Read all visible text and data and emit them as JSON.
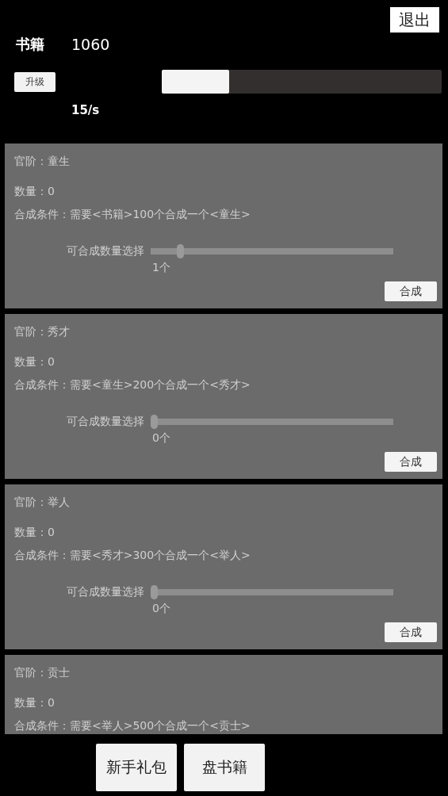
{
  "exit_button": "退出",
  "resource": {
    "label": "书籍",
    "value": "1060",
    "rate": "15/s"
  },
  "upgrade_button": "升级",
  "progress": {
    "level": 0.24
  },
  "ranks": [
    {
      "title": "官阶：童生",
      "count": "数量：0",
      "condition": "合成条件：需要<书籍>100个合成一个<童生>",
      "slider_label": "可合成数量选择",
      "level": 0.11,
      "amount": "1个",
      "button": "合成"
    },
    {
      "title": "官阶：秀才",
      "count": "数量：0",
      "condition": "合成条件：需要<童生>200个合成一个<秀才>",
      "slider_label": "可合成数量选择",
      "level": 0,
      "amount": "0个",
      "button": "合成"
    },
    {
      "title": "官阶：举人",
      "count": "数量：0",
      "condition": "合成条件：需要<秀才>300个合成一个<举人>",
      "slider_label": "可合成数量选择",
      "level": 0,
      "amount": "0个",
      "button": "合成"
    },
    {
      "title": "官阶：贡士",
      "count": "数量：0",
      "condition": "合成条件：需要<举人>500个合成一个<贡士>"
    }
  ],
  "bottom_buttons": [
    "新手礼包",
    "盘书籍"
  ]
}
